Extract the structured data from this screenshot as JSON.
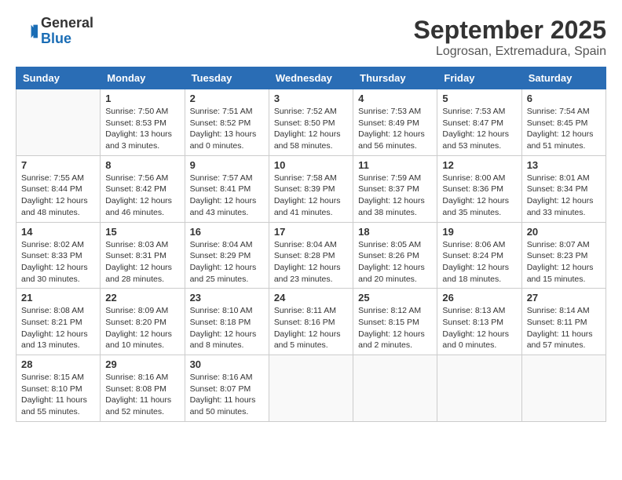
{
  "header": {
    "logo_general": "General",
    "logo_blue": "Blue",
    "month": "September 2025",
    "location": "Logrosan, Extremadura, Spain"
  },
  "weekdays": [
    "Sunday",
    "Monday",
    "Tuesday",
    "Wednesday",
    "Thursday",
    "Friday",
    "Saturday"
  ],
  "weeks": [
    [
      {
        "day": "",
        "info": ""
      },
      {
        "day": "1",
        "info": "Sunrise: 7:50 AM\nSunset: 8:53 PM\nDaylight: 13 hours\nand 3 minutes."
      },
      {
        "day": "2",
        "info": "Sunrise: 7:51 AM\nSunset: 8:52 PM\nDaylight: 13 hours\nand 0 minutes."
      },
      {
        "day": "3",
        "info": "Sunrise: 7:52 AM\nSunset: 8:50 PM\nDaylight: 12 hours\nand 58 minutes."
      },
      {
        "day": "4",
        "info": "Sunrise: 7:53 AM\nSunset: 8:49 PM\nDaylight: 12 hours\nand 56 minutes."
      },
      {
        "day": "5",
        "info": "Sunrise: 7:53 AM\nSunset: 8:47 PM\nDaylight: 12 hours\nand 53 minutes."
      },
      {
        "day": "6",
        "info": "Sunrise: 7:54 AM\nSunset: 8:45 PM\nDaylight: 12 hours\nand 51 minutes."
      }
    ],
    [
      {
        "day": "7",
        "info": "Sunrise: 7:55 AM\nSunset: 8:44 PM\nDaylight: 12 hours\nand 48 minutes."
      },
      {
        "day": "8",
        "info": "Sunrise: 7:56 AM\nSunset: 8:42 PM\nDaylight: 12 hours\nand 46 minutes."
      },
      {
        "day": "9",
        "info": "Sunrise: 7:57 AM\nSunset: 8:41 PM\nDaylight: 12 hours\nand 43 minutes."
      },
      {
        "day": "10",
        "info": "Sunrise: 7:58 AM\nSunset: 8:39 PM\nDaylight: 12 hours\nand 41 minutes."
      },
      {
        "day": "11",
        "info": "Sunrise: 7:59 AM\nSunset: 8:37 PM\nDaylight: 12 hours\nand 38 minutes."
      },
      {
        "day": "12",
        "info": "Sunrise: 8:00 AM\nSunset: 8:36 PM\nDaylight: 12 hours\nand 35 minutes."
      },
      {
        "day": "13",
        "info": "Sunrise: 8:01 AM\nSunset: 8:34 PM\nDaylight: 12 hours\nand 33 minutes."
      }
    ],
    [
      {
        "day": "14",
        "info": "Sunrise: 8:02 AM\nSunset: 8:33 PM\nDaylight: 12 hours\nand 30 minutes."
      },
      {
        "day": "15",
        "info": "Sunrise: 8:03 AM\nSunset: 8:31 PM\nDaylight: 12 hours\nand 28 minutes."
      },
      {
        "day": "16",
        "info": "Sunrise: 8:04 AM\nSunset: 8:29 PM\nDaylight: 12 hours\nand 25 minutes."
      },
      {
        "day": "17",
        "info": "Sunrise: 8:04 AM\nSunset: 8:28 PM\nDaylight: 12 hours\nand 23 minutes."
      },
      {
        "day": "18",
        "info": "Sunrise: 8:05 AM\nSunset: 8:26 PM\nDaylight: 12 hours\nand 20 minutes."
      },
      {
        "day": "19",
        "info": "Sunrise: 8:06 AM\nSunset: 8:24 PM\nDaylight: 12 hours\nand 18 minutes."
      },
      {
        "day": "20",
        "info": "Sunrise: 8:07 AM\nSunset: 8:23 PM\nDaylight: 12 hours\nand 15 minutes."
      }
    ],
    [
      {
        "day": "21",
        "info": "Sunrise: 8:08 AM\nSunset: 8:21 PM\nDaylight: 12 hours\nand 13 minutes."
      },
      {
        "day": "22",
        "info": "Sunrise: 8:09 AM\nSunset: 8:20 PM\nDaylight: 12 hours\nand 10 minutes."
      },
      {
        "day": "23",
        "info": "Sunrise: 8:10 AM\nSunset: 8:18 PM\nDaylight: 12 hours\nand 8 minutes."
      },
      {
        "day": "24",
        "info": "Sunrise: 8:11 AM\nSunset: 8:16 PM\nDaylight: 12 hours\nand 5 minutes."
      },
      {
        "day": "25",
        "info": "Sunrise: 8:12 AM\nSunset: 8:15 PM\nDaylight: 12 hours\nand 2 minutes."
      },
      {
        "day": "26",
        "info": "Sunrise: 8:13 AM\nSunset: 8:13 PM\nDaylight: 12 hours\nand 0 minutes."
      },
      {
        "day": "27",
        "info": "Sunrise: 8:14 AM\nSunset: 8:11 PM\nDaylight: 11 hours\nand 57 minutes."
      }
    ],
    [
      {
        "day": "28",
        "info": "Sunrise: 8:15 AM\nSunset: 8:10 PM\nDaylight: 11 hours\nand 55 minutes."
      },
      {
        "day": "29",
        "info": "Sunrise: 8:16 AM\nSunset: 8:08 PM\nDaylight: 11 hours\nand 52 minutes."
      },
      {
        "day": "30",
        "info": "Sunrise: 8:16 AM\nSunset: 8:07 PM\nDaylight: 11 hours\nand 50 minutes."
      },
      {
        "day": "",
        "info": ""
      },
      {
        "day": "",
        "info": ""
      },
      {
        "day": "",
        "info": ""
      },
      {
        "day": "",
        "info": ""
      }
    ]
  ]
}
